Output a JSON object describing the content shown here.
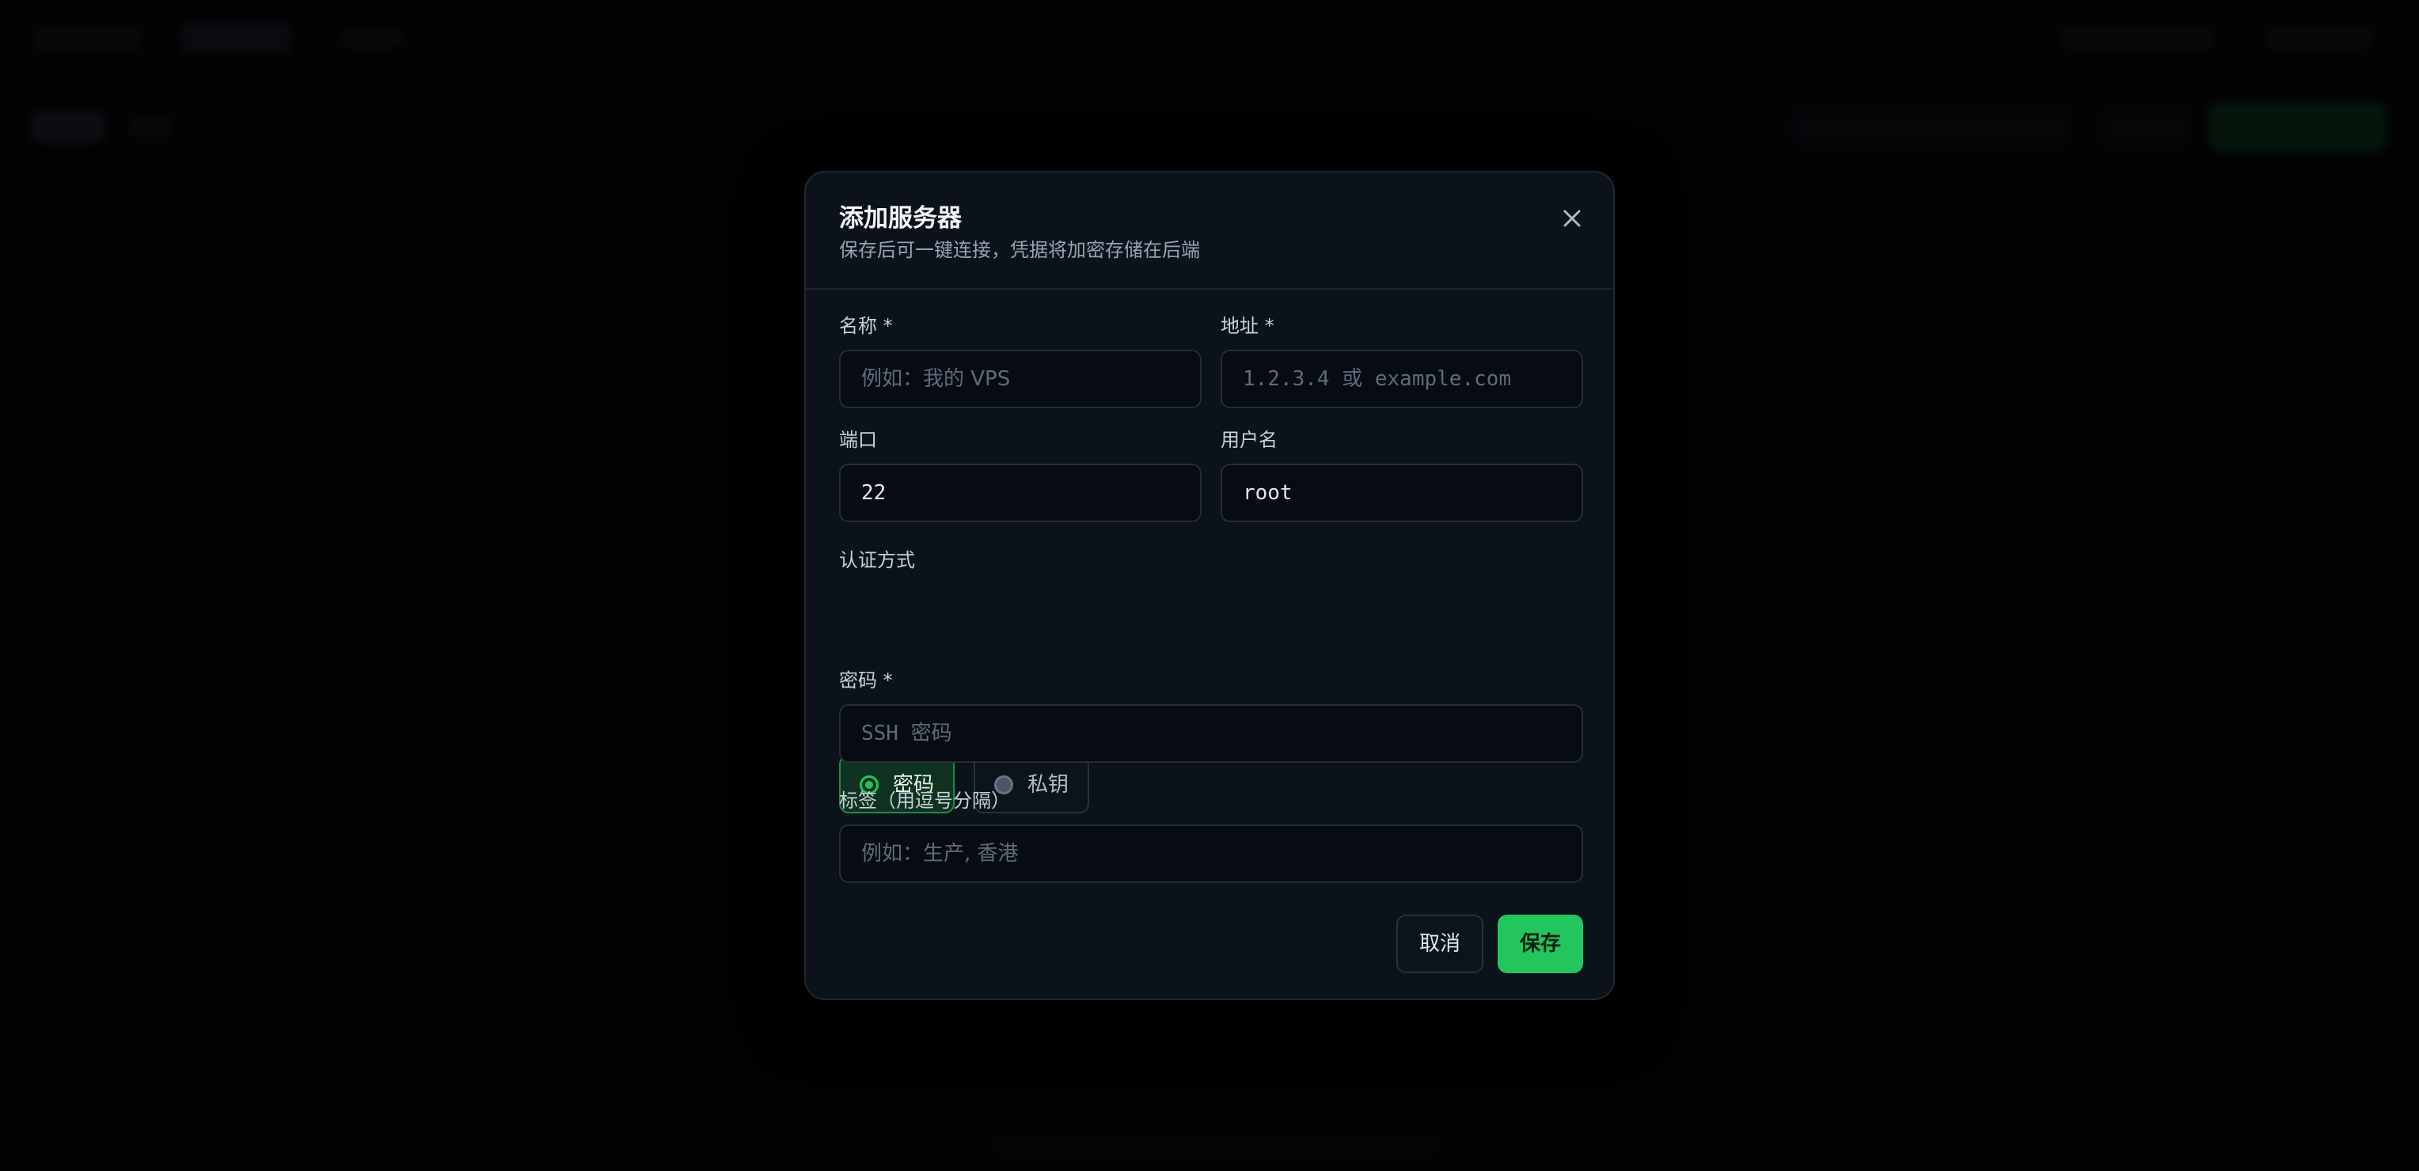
{
  "modal": {
    "title": "添加服务器",
    "subtitle": "保存后可一键连接，凭据将加密存储在后端",
    "close_icon": "close-icon"
  },
  "form": {
    "name": {
      "label": "名称 *",
      "placeholder": "例如：我的 VPS",
      "value": ""
    },
    "address": {
      "label": "地址 *",
      "placeholder": "1.2.3.4 或 example.com",
      "value": ""
    },
    "port": {
      "label": "端口",
      "placeholder": "",
      "value": "22"
    },
    "username": {
      "label": "用户名",
      "placeholder": "",
      "value": "root"
    },
    "auth": {
      "label": "认证方式",
      "options": [
        {
          "label": "密码",
          "selected": true
        },
        {
          "label": "私钥",
          "selected": false
        }
      ]
    },
    "password": {
      "label": "密码 *",
      "placeholder": "SSH 密码",
      "value": ""
    },
    "tags": {
      "label": "标签（用逗号分隔）",
      "placeholder": "例如：生产, 香港",
      "value": ""
    }
  },
  "actions": {
    "cancel_label": "取消",
    "save_label": "保存"
  },
  "colors": {
    "accent": "#22c55e",
    "modal_bg": "#0c1219",
    "input_bg": "#070b12"
  }
}
